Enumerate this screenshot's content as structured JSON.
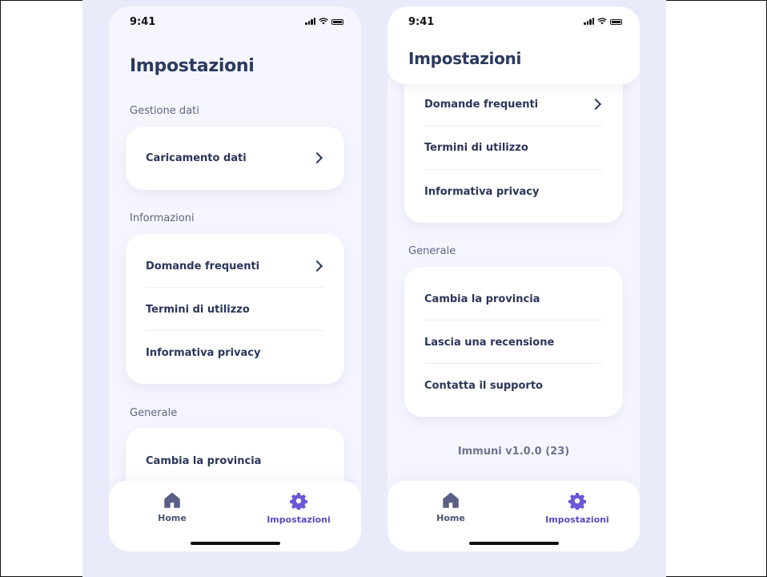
{
  "status": {
    "time": "9:41"
  },
  "left": {
    "title": "Impostazioni",
    "sections": [
      {
        "label": "Gestione dati",
        "items": [
          "Caricamento dati"
        ]
      },
      {
        "label": "Informazioni",
        "items": [
          "Domande frequenti",
          "Termini di utilizzo",
          "Informativa privacy"
        ]
      },
      {
        "label": "Generale",
        "items": [
          "Cambia la provincia"
        ]
      }
    ]
  },
  "right": {
    "title": "Impostazioni",
    "info_items": [
      "Domande frequenti",
      "Termini di utilizzo",
      "Informativa privacy"
    ],
    "general_label": "Generale",
    "general_items": [
      "Cambia la provincia",
      "Lascia una recensione",
      "Contatta il supporto"
    ],
    "version": "Immuni  v1.0.0 (23)"
  },
  "tabbar": {
    "home_label": "Home",
    "settings_label": "Impostazioni"
  },
  "colors": {
    "accent": "#6a58d6",
    "home_icon": "#5b5e87",
    "background": "#e9ebfa"
  },
  "icons": {
    "home": "home-icon",
    "settings": "gear-icon",
    "chevron": "chevron-right-icon"
  }
}
